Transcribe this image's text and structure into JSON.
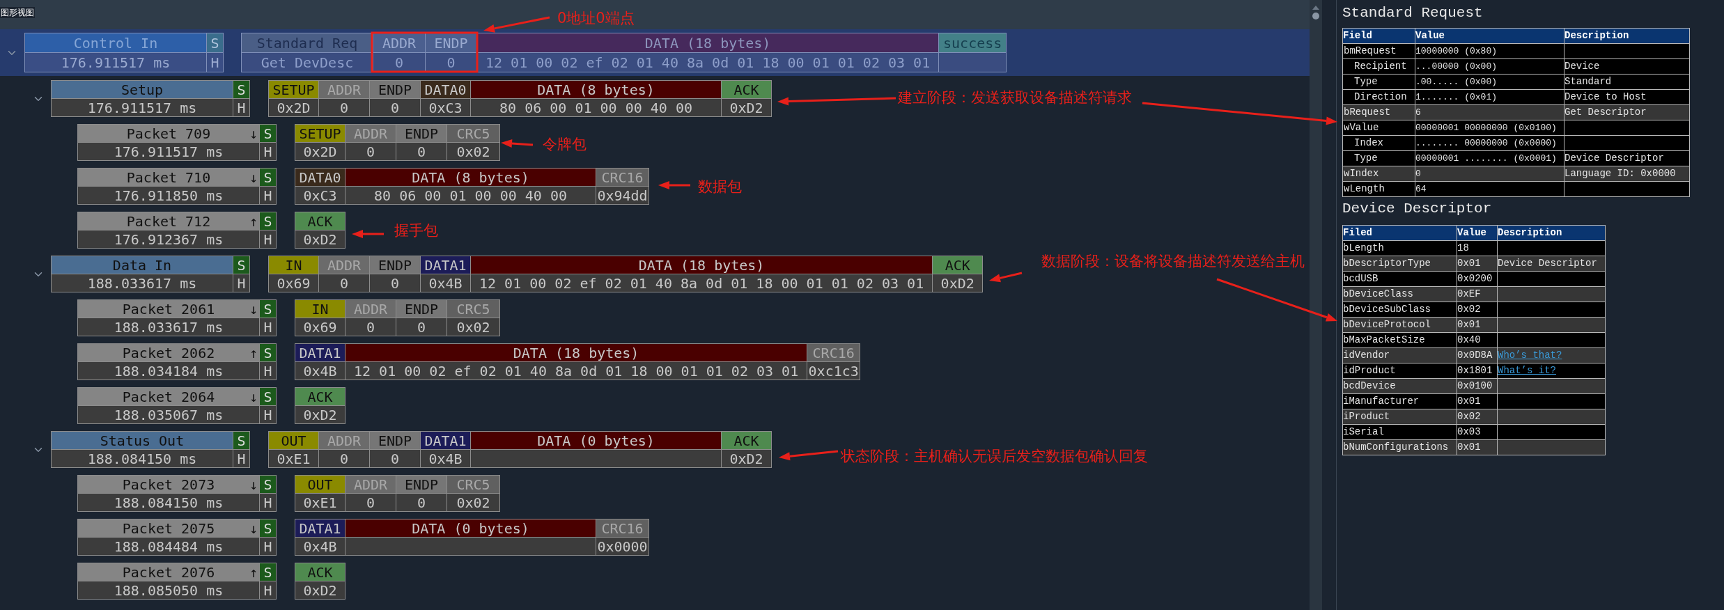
{
  "panel_title": "图形视图",
  "transaction": {
    "expanded": true,
    "name": "Control In",
    "time": "176.911517 ms",
    "flag_top": "S",
    "flag_bottom": "H",
    "fields": [
      {
        "kind": "request",
        "header": "Standard Req",
        "value": "Get DevDesc"
      },
      {
        "kind": "addr",
        "header": "ADDR",
        "value": "0"
      },
      {
        "kind": "endp",
        "header": "ENDP",
        "value": "0"
      },
      {
        "kind": "data",
        "header": "DATA (18 bytes)",
        "value": "12 01 00 02 ef 02 01 40 8a 0d 01 18 00 01 01 02 03 01"
      },
      {
        "kind": "status",
        "header": "success"
      }
    ]
  },
  "stages": [
    {
      "expanded": true,
      "name": "Setup",
      "time": "176.911517 ms",
      "flag_top": "S",
      "flag_bottom": "H",
      "fields": [
        {
          "kind": "token",
          "header": "SETUP",
          "value": "0x2D"
        },
        {
          "kind": "addr",
          "header": "ADDR",
          "value": "0"
        },
        {
          "kind": "endp",
          "header": "ENDP",
          "value": "0"
        },
        {
          "kind": "data0",
          "header": "DATA0",
          "value": "0xC3"
        },
        {
          "kind": "data",
          "header": "DATA (8 bytes)",
          "value": "80 06 00 01 00 00 40 00"
        },
        {
          "kind": "handshake",
          "header": "ACK",
          "value": "0xD2"
        }
      ],
      "packets": [
        {
          "name": "Packet 709",
          "direction": "↓",
          "time": "176.911517 ms",
          "flag_top": "S",
          "flag_bottom": "H",
          "fields": [
            {
              "kind": "token",
              "header": "SETUP",
              "value": "0x2D"
            },
            {
              "kind": "addr",
              "header": "ADDR",
              "value": "0"
            },
            {
              "kind": "endp",
              "header": "ENDP",
              "value": "0"
            },
            {
              "kind": "crc",
              "header": "CRC5",
              "value": "0x02"
            }
          ]
        },
        {
          "name": "Packet 710",
          "direction": "↓",
          "time": "176.911850 ms",
          "flag_top": "S",
          "flag_bottom": "H",
          "fields": [
            {
              "kind": "data0",
              "header": "DATA0",
              "value": "0xC3"
            },
            {
              "kind": "data",
              "header": "DATA (8 bytes)",
              "value": "80 06 00 01 00 00 40 00"
            },
            {
              "kind": "crc",
              "header": "CRC16",
              "value": "0x94dd"
            }
          ]
        },
        {
          "name": "Packet 712",
          "direction": "↑",
          "time": "176.912367 ms",
          "flag_top": "S",
          "flag_bottom": "H",
          "fields": [
            {
              "kind": "handshake",
              "header": "ACK",
              "value": "0xD2"
            }
          ]
        }
      ]
    },
    {
      "expanded": true,
      "name": "Data In",
      "time": "188.033617 ms",
      "flag_top": "S",
      "flag_bottom": "H",
      "fields": [
        {
          "kind": "token",
          "header": "IN",
          "value": "0x69"
        },
        {
          "kind": "addr",
          "header": "ADDR",
          "value": "0"
        },
        {
          "kind": "endp",
          "header": "ENDP",
          "value": "0"
        },
        {
          "kind": "data1",
          "header": "DATA1",
          "value": "0x4B"
        },
        {
          "kind": "data",
          "header": "DATA (18 bytes)",
          "value": "12 01 00 02 ef 02 01 40 8a 0d 01 18 00 01 01 02 03 01"
        },
        {
          "kind": "handshake",
          "header": "ACK",
          "value": "0xD2"
        }
      ],
      "packets": [
        {
          "name": "Packet 2061",
          "direction": "↓",
          "time": "188.033617 ms",
          "flag_top": "S",
          "flag_bottom": "H",
          "fields": [
            {
              "kind": "token",
              "header": "IN",
              "value": "0x69"
            },
            {
              "kind": "addr",
              "header": "ADDR",
              "value": "0"
            },
            {
              "kind": "endp",
              "header": "ENDP",
              "value": "0"
            },
            {
              "kind": "crc",
              "header": "CRC5",
              "value": "0x02"
            }
          ]
        },
        {
          "name": "Packet 2062",
          "direction": "↑",
          "time": "188.034184 ms",
          "flag_top": "S",
          "flag_bottom": "H",
          "fields": [
            {
              "kind": "data1",
              "header": "DATA1",
              "value": "0x4B"
            },
            {
              "kind": "data",
              "header": "DATA (18 bytes)",
              "value": "12 01 00 02 ef 02 01 40 8a 0d 01 18 00 01 01 02 03 01"
            },
            {
              "kind": "crc",
              "header": "CRC16",
              "value": "0xc1c3"
            }
          ]
        },
        {
          "name": "Packet 2064",
          "direction": "↓",
          "time": "188.035067 ms",
          "flag_top": "S",
          "flag_bottom": "H",
          "fields": [
            {
              "kind": "handshake",
              "header": "ACK",
              "value": "0xD2"
            }
          ]
        }
      ]
    },
    {
      "expanded": true,
      "name": "Status Out",
      "time": "188.084150 ms",
      "flag_top": "S",
      "flag_bottom": "H",
      "fields": [
        {
          "kind": "token",
          "header": "OUT",
          "value": "0xE1"
        },
        {
          "kind": "addr",
          "header": "ADDR",
          "value": "0"
        },
        {
          "kind": "endp",
          "header": "ENDP",
          "value": "0"
        },
        {
          "kind": "data1",
          "header": "DATA1",
          "value": "0x4B"
        },
        {
          "kind": "data",
          "header": "DATA (0 bytes)"
        },
        {
          "kind": "handshake",
          "header": "ACK",
          "value": "0xD2"
        }
      ],
      "packets": [
        {
          "name": "Packet 2073",
          "direction": "↓",
          "time": "188.084150 ms",
          "flag_top": "S",
          "flag_bottom": "H",
          "fields": [
            {
              "kind": "token",
              "header": "OUT",
              "value": "0xE1"
            },
            {
              "kind": "addr",
              "header": "ADDR",
              "value": "0"
            },
            {
              "kind": "endp",
              "header": "ENDP",
              "value": "0"
            },
            {
              "kind": "crc",
              "header": "CRC5",
              "value": "0x02"
            }
          ]
        },
        {
          "name": "Packet 2075",
          "direction": "↓",
          "time": "188.084484 ms",
          "flag_top": "S",
          "flag_bottom": "H",
          "fields": [
            {
              "kind": "data1",
              "header": "DATA1",
              "value": "0x4B"
            },
            {
              "kind": "data",
              "header": "DATA (0 bytes)"
            },
            {
              "kind": "crc",
              "header": "CRC16",
              "value": "0x0000"
            }
          ]
        },
        {
          "name": "Packet 2076",
          "direction": "↑",
          "time": "188.085050 ms",
          "flag_top": "S",
          "flag_bottom": "H",
          "fields": [
            {
              "kind": "handshake",
              "header": "ACK",
              "value": "0xD2"
            }
          ]
        }
      ]
    }
  ],
  "annotations": [
    {
      "text": "0地址0端点"
    },
    {
      "text": "建立阶段：发送获取设备描述符请求"
    },
    {
      "text": "令牌包"
    },
    {
      "text": "数据包"
    },
    {
      "text": "握手包"
    },
    {
      "text": "数据阶段：设备将设备描述符发送给主机"
    },
    {
      "text": "状态阶段：主机确认无误后发空数据包确认回复"
    }
  ],
  "request_panel": {
    "title": "Standard Request",
    "columns": [
      "Field",
      "Value",
      "Description"
    ],
    "rows": [
      {
        "field": "bmRequest",
        "value": "10000000 (0x80)",
        "highlighted": false,
        "children": [
          {
            "field": "Recipient",
            "value": "...00000 (0x00)",
            "description": "Device",
            "highlighted": false
          },
          {
            "field": "Type",
            "value": ".00..... (0x00)",
            "description": "Standard",
            "highlighted": false
          },
          {
            "field": "Direction",
            "value": "1....... (0x01)",
            "description": "Device to Host",
            "highlighted": false
          }
        ]
      },
      {
        "field": "bRequest",
        "value": "6",
        "description": "Get Descriptor",
        "highlighted": true
      },
      {
        "field": "wValue",
        "value": "00000001 00000000 (0x0100)",
        "highlighted": false,
        "children": [
          {
            "field": "Index",
            "value": "........ 00000000 (0x0000)",
            "highlighted": false
          },
          {
            "field": "Type",
            "value": "00000001 ........ (0x0001)",
            "description": "Device Descriptor",
            "highlighted": false
          }
        ]
      },
      {
        "field": "wIndex",
        "value": "0",
        "description": "Language ID: 0x0000",
        "highlighted": true
      },
      {
        "field": "wLength",
        "value": "64",
        "highlighted": false
      }
    ]
  },
  "descriptor_panel": {
    "title": "Device Descriptor",
    "columns": [
      "Filed",
      "Value",
      "Description"
    ],
    "rows": [
      {
        "field": "bLength",
        "value": "18"
      },
      {
        "field": "bDescriptorType",
        "value": "0x01",
        "description": "Device Descriptor"
      },
      {
        "field": "bcdUSB",
        "value": "0x0200"
      },
      {
        "field": "bDeviceClass",
        "value": "0xEF"
      },
      {
        "field": "bDeviceSubClass",
        "value": "0x02"
      },
      {
        "field": "bDeviceProtocol",
        "value": "0x01"
      },
      {
        "field": "bMaxPacketSize",
        "value": "0x40"
      },
      {
        "field": "idVendor",
        "value": "0x0D8A",
        "link": "Who’s that?"
      },
      {
        "field": "idProduct",
        "value": "0x1801",
        "link": "What’s it?"
      },
      {
        "field": "bcdDevice",
        "value": "0x0100"
      },
      {
        "field": "iManufacturer",
        "value": "0x01"
      },
      {
        "field": "iProduct",
        "value": "0x02"
      },
      {
        "field": "iSerial",
        "value": "0x03"
      },
      {
        "field": "bNumConfigurations",
        "value": "0x01"
      }
    ]
  }
}
